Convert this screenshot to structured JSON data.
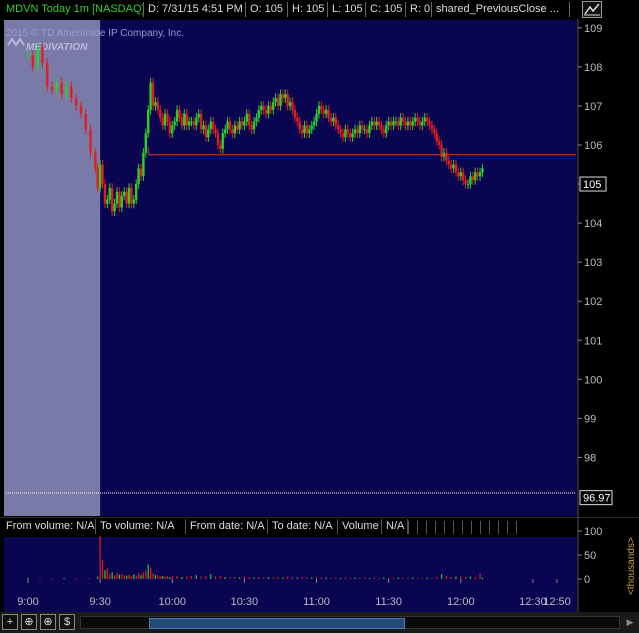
{
  "header": {
    "symbol": "MDVN Today 1m [NASDAQ]",
    "date": "D: 7/31/15 4:51 PM",
    "open": "O: 105",
    "high": "H: 105",
    "low": "L: 105",
    "close": "C: 105",
    "range": "R: 0",
    "study": "shared_PreviousClose ..."
  },
  "watermark": {
    "copyright": "2015 © TD Ameritrade IP Company, Inc.",
    "logo": "MEDIVATION"
  },
  "colors": {
    "panel_bg": "#0a0550",
    "premarket_bg": "#7a7aa8",
    "up": "#2bd12b",
    "down": "#e01e1e",
    "grid": "#4a4a8a",
    "axis_text": "#bbbbbb",
    "prev_close": "#e03a1e"
  },
  "chart_data": {
    "type": "candlestick",
    "ylim": [
      96.5,
      109.2
    ],
    "y_ticks": [
      98,
      99,
      100,
      101,
      102,
      103,
      104,
      105,
      106,
      107,
      108,
      109
    ],
    "x_ticks": [
      "9:00",
      "9:30",
      "10:00",
      "10:30",
      "11:00",
      "11:30",
      "12:00",
      "12:30",
      "12:50"
    ],
    "x_range_minutes": [
      0,
      225
    ],
    "last_price": "105",
    "previous_close_value": 105.75,
    "extra_price_label": "96.97",
    "extended_hours_end_minute": 30,
    "ohlc_points": [
      [
        0,
        108.3
      ],
      [
        2,
        108.0
      ],
      [
        4,
        108.5
      ],
      [
        6,
        108.1
      ],
      [
        8,
        107.5
      ],
      [
        10,
        107.4
      ],
      [
        12,
        107.6
      ],
      [
        14,
        107.3
      ],
      [
        16,
        107.5
      ],
      [
        18,
        107.2
      ],
      [
        20,
        107.0
      ],
      [
        22,
        106.8
      ],
      [
        24,
        106.4
      ],
      [
        26,
        105.8
      ],
      [
        28,
        105.4
      ],
      [
        29,
        104.9
      ],
      [
        30,
        105.5
      ],
      [
        31,
        105.0
      ],
      [
        32,
        104.5
      ],
      [
        33,
        104.6
      ],
      [
        34,
        104.9
      ],
      [
        35,
        104.3
      ],
      [
        36,
        104.5
      ],
      [
        37,
        104.8
      ],
      [
        38,
        104.4
      ],
      [
        39,
        104.7
      ],
      [
        40,
        104.8
      ],
      [
        41,
        104.5
      ],
      [
        42,
        104.9
      ],
      [
        43,
        104.5
      ],
      [
        44,
        104.6
      ],
      [
        45,
        105.0
      ],
      [
        46,
        105.4
      ],
      [
        47,
        105.2
      ],
      [
        48,
        105.8
      ],
      [
        49,
        106.3
      ],
      [
        50,
        106.9
      ],
      [
        51,
        107.6
      ],
      [
        52,
        107.0
      ],
      [
        53,
        107.1
      ],
      [
        54,
        106.9
      ],
      [
        55,
        106.7
      ],
      [
        56,
        106.5
      ],
      [
        57,
        106.8
      ],
      [
        58,
        106.6
      ],
      [
        59,
        106.3
      ],
      [
        60,
        106.5
      ],
      [
        61,
        106.6
      ],
      [
        62,
        106.9
      ],
      [
        63,
        106.7
      ],
      [
        64,
        106.5
      ],
      [
        65,
        106.8
      ],
      [
        66,
        106.5
      ],
      [
        67,
        106.6
      ],
      [
        68,
        106.6
      ],
      [
        69,
        106.5
      ],
      [
        70,
        106.7
      ],
      [
        71,
        106.8
      ],
      [
        72,
        106.4
      ],
      [
        73,
        106.5
      ],
      [
        74,
        106.2
      ],
      [
        75,
        106.4
      ],
      [
        76,
        106.6
      ],
      [
        77,
        106.4
      ],
      [
        78,
        106.3
      ],
      [
        79,
        106.0
      ],
      [
        80,
        105.9
      ],
      [
        81,
        106.3
      ],
      [
        82,
        106.4
      ],
      [
        83,
        106.6
      ],
      [
        84,
        106.4
      ],
      [
        85,
        106.3
      ],
      [
        86,
        106.5
      ],
      [
        87,
        106.4
      ],
      [
        88,
        106.6
      ],
      [
        89,
        106.5
      ],
      [
        90,
        106.6
      ],
      [
        91,
        106.8
      ],
      [
        92,
        106.5
      ],
      [
        93,
        106.4
      ],
      [
        94,
        106.6
      ],
      [
        95,
        106.7
      ],
      [
        96,
        106.9
      ],
      [
        97,
        107.0
      ],
      [
        98,
        106.9
      ],
      [
        99,
        106.8
      ],
      [
        100,
        107.0
      ],
      [
        101,
        106.9
      ],
      [
        102,
        107.1
      ],
      [
        103,
        107.2
      ],
      [
        104,
        107.0
      ],
      [
        105,
        107.3
      ],
      [
        106,
        107.2
      ],
      [
        107,
        107.3
      ],
      [
        108,
        107.0
      ],
      [
        109,
        107.1
      ],
      [
        110,
        106.9
      ],
      [
        111,
        106.7
      ],
      [
        112,
        106.6
      ],
      [
        113,
        106.4
      ],
      [
        114,
        106.3
      ],
      [
        115,
        106.5
      ],
      [
        116,
        106.3
      ],
      [
        117,
        106.4
      ],
      [
        118,
        106.5
      ],
      [
        119,
        106.6
      ],
      [
        120,
        106.8
      ],
      [
        121,
        107.0
      ],
      [
        122,
        106.9
      ],
      [
        123,
        106.8
      ],
      [
        124,
        106.9
      ],
      [
        125,
        106.7
      ],
      [
        126,
        106.6
      ],
      [
        127,
        106.7
      ],
      [
        128,
        106.5
      ],
      [
        129,
        106.4
      ],
      [
        130,
        106.3
      ],
      [
        131,
        106.2
      ],
      [
        132,
        106.4
      ],
      [
        133,
        106.3
      ],
      [
        134,
        106.2
      ],
      [
        135,
        106.3
      ],
      [
        136,
        106.4
      ],
      [
        137,
        106.3
      ],
      [
        138,
        106.5
      ],
      [
        139,
        106.4
      ],
      [
        140,
        106.4
      ],
      [
        141,
        106.3
      ],
      [
        142,
        106.5
      ],
      [
        143,
        106.6
      ],
      [
        144,
        106.5
      ],
      [
        145,
        106.6
      ],
      [
        146,
        106.5
      ],
      [
        147,
        106.4
      ],
      [
        148,
        106.3
      ],
      [
        149,
        106.5
      ],
      [
        150,
        106.6
      ],
      [
        151,
        106.5
      ],
      [
        152,
        106.6
      ],
      [
        153,
        106.6
      ],
      [
        154,
        106.5
      ],
      [
        155,
        106.7
      ],
      [
        156,
        106.6
      ],
      [
        157,
        106.5
      ],
      [
        158,
        106.6
      ],
      [
        159,
        106.5
      ],
      [
        160,
        106.6
      ],
      [
        161,
        106.7
      ],
      [
        162,
        106.6
      ],
      [
        163,
        106.5
      ],
      [
        164,
        106.6
      ],
      [
        165,
        106.7
      ],
      [
        166,
        106.6
      ],
      [
        167,
        106.5
      ],
      [
        168,
        106.4
      ],
      [
        169,
        106.3
      ],
      [
        170,
        106.1
      ],
      [
        171,
        106.0
      ],
      [
        172,
        105.7
      ],
      [
        173,
        105.8
      ],
      [
        174,
        105.6
      ],
      [
        175,
        105.5
      ],
      [
        176,
        105.4
      ],
      [
        177,
        105.5
      ],
      [
        178,
        105.3
      ],
      [
        179,
        105.2
      ],
      [
        180,
        105.3
      ],
      [
        181,
        105.1
      ],
      [
        182,
        105.0
      ],
      [
        183,
        105.0
      ],
      [
        184,
        105.2
      ],
      [
        185,
        105.1
      ],
      [
        186,
        105.3
      ],
      [
        187,
        105.2
      ],
      [
        188,
        105.3
      ],
      [
        189,
        105.4
      ]
    ],
    "volume_panel": {
      "ylim": [
        0,
        100
      ],
      "y_ticks": [
        0,
        50,
        100
      ],
      "unit_label": "<thousands>",
      "status": {
        "from_volume": "From volume: N/A",
        "to_volume": "To volume: N/A",
        "from_date": "From date: N/A",
        "to_date": "To date: N/A",
        "volume_label": "Volume",
        "volume_value": "N/A"
      },
      "bars": [
        [
          0,
          2
        ],
        [
          5,
          1
        ],
        [
          10,
          1
        ],
        [
          15,
          2
        ],
        [
          20,
          1
        ],
        [
          25,
          2
        ],
        [
          29,
          5
        ],
        [
          30,
          90
        ],
        [
          31,
          40
        ],
        [
          32,
          18
        ],
        [
          33,
          22
        ],
        [
          34,
          10
        ],
        [
          35,
          14
        ],
        [
          36,
          8
        ],
        [
          37,
          12
        ],
        [
          38,
          9
        ],
        [
          39,
          10
        ],
        [
          40,
          8
        ],
        [
          41,
          7
        ],
        [
          42,
          9
        ],
        [
          43,
          6
        ],
        [
          44,
          10
        ],
        [
          45,
          7
        ],
        [
          46,
          12
        ],
        [
          47,
          8
        ],
        [
          48,
          14
        ],
        [
          49,
          18
        ],
        [
          50,
          30
        ],
        [
          51,
          24
        ],
        [
          52,
          12
        ],
        [
          53,
          9
        ],
        [
          54,
          8
        ],
        [
          55,
          7
        ],
        [
          56,
          6
        ],
        [
          57,
          5
        ],
        [
          58,
          6
        ],
        [
          59,
          4
        ],
        [
          60,
          5
        ],
        [
          62,
          6
        ],
        [
          64,
          4
        ],
        [
          66,
          5
        ],
        [
          68,
          6
        ],
        [
          70,
          8
        ],
        [
          72,
          5
        ],
        [
          74,
          6
        ],
        [
          76,
          10
        ],
        [
          78,
          5
        ],
        [
          80,
          6
        ],
        [
          82,
          4
        ],
        [
          84,
          3
        ],
        [
          86,
          4
        ],
        [
          88,
          3
        ],
        [
          90,
          5
        ],
        [
          92,
          4
        ],
        [
          94,
          3
        ],
        [
          96,
          4
        ],
        [
          98,
          3
        ],
        [
          100,
          4
        ],
        [
          102,
          3
        ],
        [
          104,
          4
        ],
        [
          106,
          3
        ],
        [
          108,
          5
        ],
        [
          110,
          4
        ],
        [
          112,
          3
        ],
        [
          114,
          4
        ],
        [
          116,
          3
        ],
        [
          118,
          3
        ],
        [
          120,
          4
        ],
        [
          122,
          3
        ],
        [
          124,
          3
        ],
        [
          126,
          2
        ],
        [
          128,
          3
        ],
        [
          130,
          2
        ],
        [
          132,
          3
        ],
        [
          134,
          2
        ],
        [
          136,
          3
        ],
        [
          138,
          2
        ],
        [
          140,
          3
        ],
        [
          142,
          2
        ],
        [
          144,
          3
        ],
        [
          146,
          2
        ],
        [
          148,
          3
        ],
        [
          150,
          2
        ],
        [
          152,
          2
        ],
        [
          154,
          3
        ],
        [
          156,
          2
        ],
        [
          158,
          2
        ],
        [
          160,
          3
        ],
        [
          162,
          2
        ],
        [
          164,
          2
        ],
        [
          166,
          3
        ],
        [
          168,
          2
        ],
        [
          170,
          4
        ],
        [
          172,
          10
        ],
        [
          174,
          6
        ],
        [
          176,
          4
        ],
        [
          178,
          5
        ],
        [
          180,
          6
        ],
        [
          182,
          4
        ],
        [
          184,
          5
        ],
        [
          186,
          4
        ],
        [
          188,
          12
        ],
        [
          189,
          3
        ]
      ]
    }
  },
  "footer": {
    "btn_expand": "+",
    "btn_zoom": "⊕",
    "btn_pan": "⊕",
    "btn_dollar": "$"
  }
}
